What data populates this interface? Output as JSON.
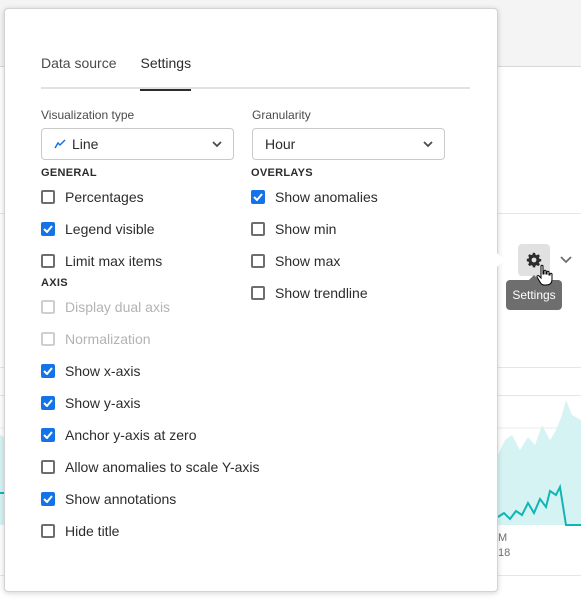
{
  "tabs": [
    {
      "label": "Data source",
      "active": false
    },
    {
      "label": "Settings",
      "active": true
    }
  ],
  "visualization": {
    "label": "Visualization type",
    "value": "Line",
    "icon": "line-chart-icon"
  },
  "granularity": {
    "label": "Granularity",
    "value": "Hour"
  },
  "general": {
    "heading": "GENERAL",
    "options": [
      {
        "label": "Percentages",
        "checked": false,
        "disabled": false
      },
      {
        "label": "Legend visible",
        "checked": true,
        "disabled": false
      },
      {
        "label": "Limit max items",
        "checked": false,
        "disabled": false
      }
    ]
  },
  "axis": {
    "heading": "AXIS",
    "options": [
      {
        "label": "Display dual axis",
        "checked": false,
        "disabled": true
      },
      {
        "label": "Normalization",
        "checked": false,
        "disabled": true
      },
      {
        "label": "Show x-axis",
        "checked": true,
        "disabled": false
      },
      {
        "label": "Show y-axis",
        "checked": true,
        "disabled": false
      },
      {
        "label": "Anchor y-axis at zero",
        "checked": true,
        "disabled": false
      },
      {
        "label": "Allow anomalies to scale Y-axis",
        "checked": false,
        "disabled": false
      },
      {
        "label": "Show annotations",
        "checked": true,
        "disabled": false
      },
      {
        "label": "Hide title",
        "checked": false,
        "disabled": false
      }
    ]
  },
  "overlays": {
    "heading": "OVERLAYS",
    "options": [
      {
        "label": "Show anomalies",
        "checked": true,
        "disabled": false
      },
      {
        "label": "Show min",
        "checked": false,
        "disabled": false
      },
      {
        "label": "Show max",
        "checked": false,
        "disabled": false
      },
      {
        "label": "Show trendline",
        "checked": false,
        "disabled": false
      }
    ]
  },
  "settings_button": {
    "icon": "gear-icon",
    "tooltip": "Settings"
  },
  "background": {
    "axis_label_time": "M",
    "axis_label_date": "18"
  },
  "colors": {
    "accent": "#1473e6",
    "line_series": "#12b5b5",
    "band": "#d6f3f3"
  }
}
